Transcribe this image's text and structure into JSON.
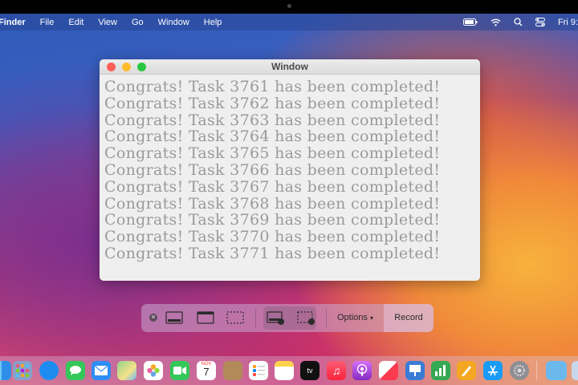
{
  "menubar": {
    "app_name": "Finder",
    "menus": [
      "File",
      "Edit",
      "View",
      "Go",
      "Window",
      "Help"
    ],
    "clock": "Fri 9:"
  },
  "window": {
    "title": "Window",
    "lines": [
      "Congrats! Task 3761 has been completed!",
      "Congrats! Task 3762 has been completed!",
      "Congrats! Task 3763 has been completed!",
      "Congrats! Task 3764 has been completed!",
      "Congrats! Task 3765 has been completed!",
      "Congrats! Task 3766 has been completed!",
      "Congrats! Task 3767 has been completed!",
      "Congrats! Task 3768 has been completed!",
      "Congrats! Task 3769 has been completed!",
      "Congrats! Task 3770 has been completed!",
      "Congrats! Task 3771 has been completed!"
    ]
  },
  "toolbar": {
    "options_label": "Options",
    "record_label": "Record"
  },
  "dock": {
    "apps": [
      "finder",
      "launchpad",
      "safari",
      "messages",
      "mail",
      "maps",
      "photos",
      "facetime",
      "calendar",
      "contacts",
      "reminders",
      "notes",
      "tv",
      "music",
      "podcasts",
      "news",
      "keynote",
      "numbers",
      "pages",
      "app-store",
      "system-preferences",
      "downloads"
    ],
    "calendar_month": "NOV",
    "calendar_day": "7",
    "tv_label": "tv"
  }
}
